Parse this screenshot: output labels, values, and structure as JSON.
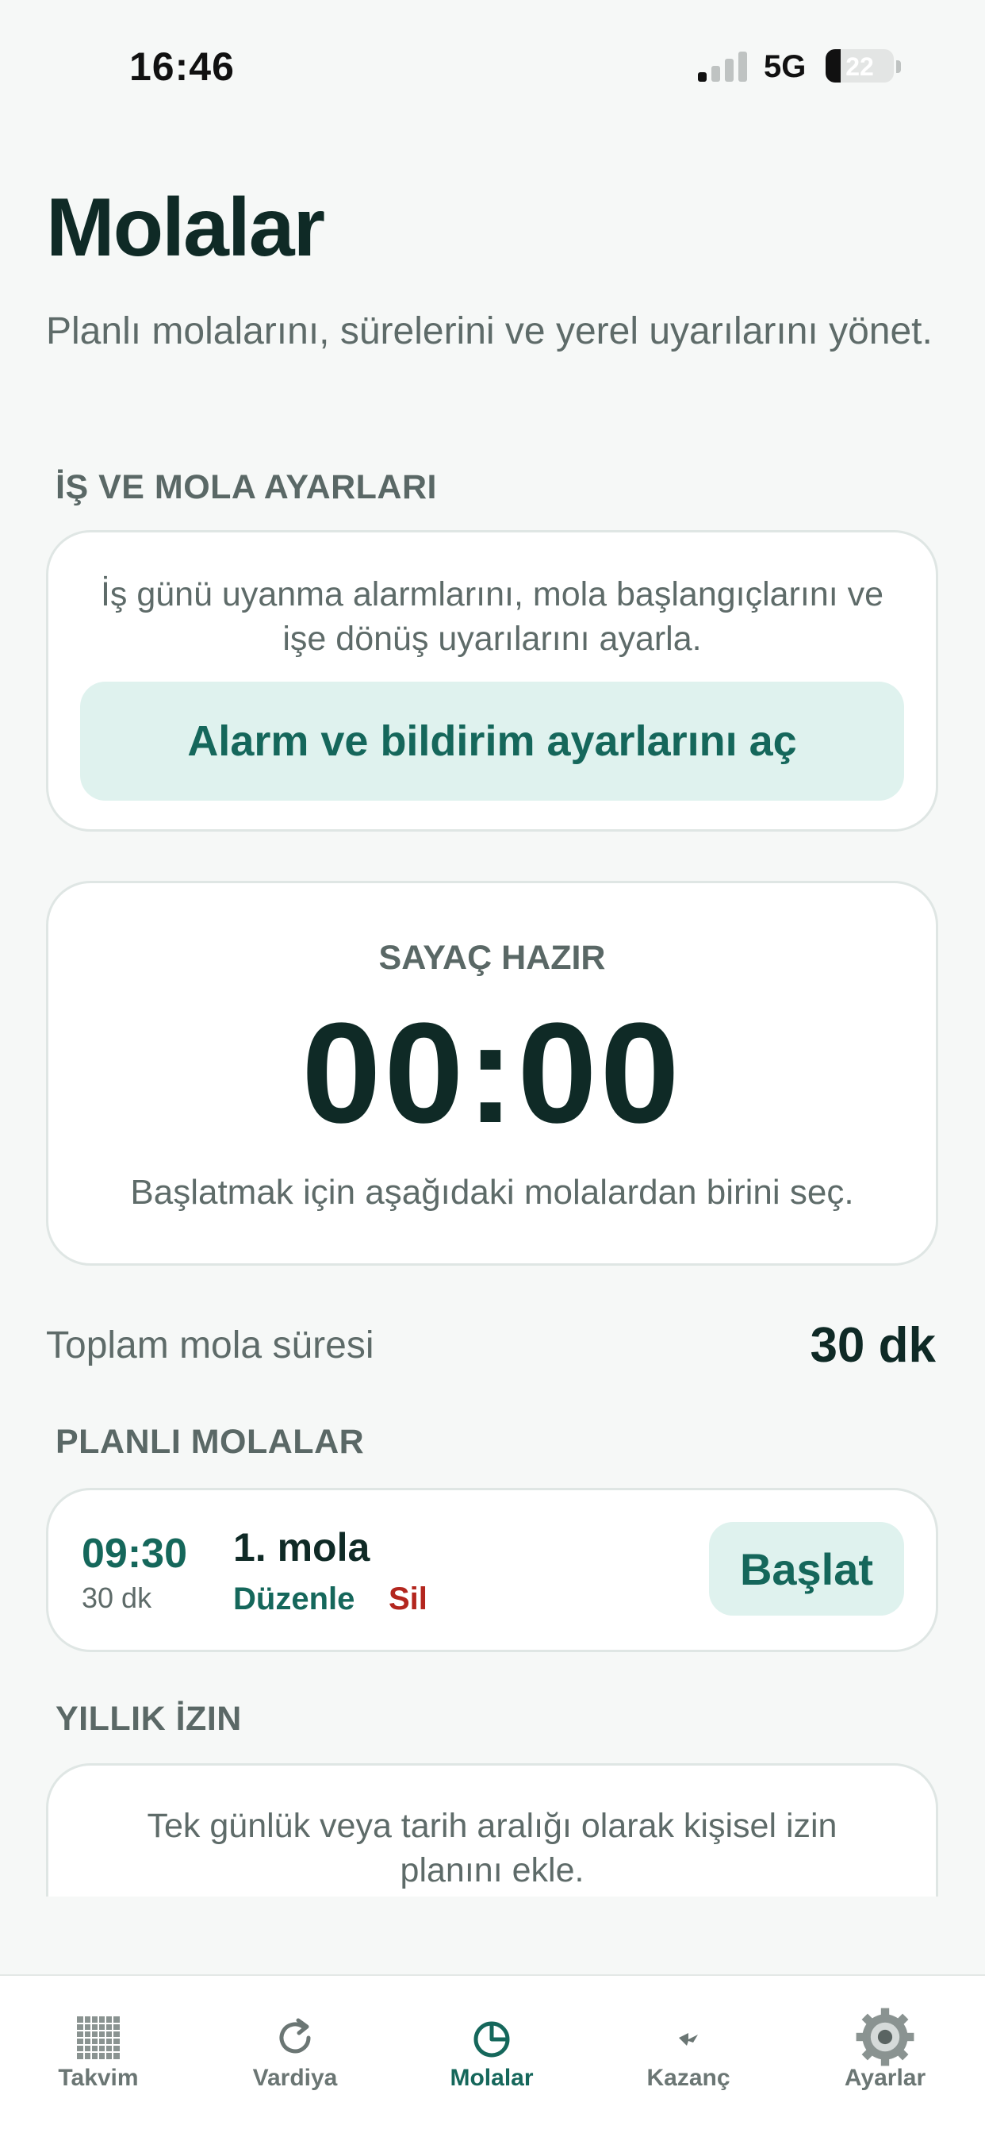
{
  "status_bar": {
    "time": "16:46",
    "network": "5G",
    "battery": "22",
    "battery_level_percent": 22
  },
  "header": {
    "title": "Molalar",
    "subtitle": "Planlı molalarını, sürelerini ve yerel uyarılarını yönet."
  },
  "settings_section": {
    "label": "İŞ VE MOLA AYARLARI",
    "description": "İş günü uyanma alarmlarını, mola başlangıçlarını ve işe dönüş uyarılarını ayarla.",
    "button_label": "Alarm ve bildirim ayarlarını aç"
  },
  "timer": {
    "status": "SAYAÇ HAZIR",
    "value": "00:00",
    "hint": "Başlatmak için aşağıdaki molalardan birini seç."
  },
  "total": {
    "label": "Toplam mola süresi",
    "value": "30 dk"
  },
  "planned_breaks": {
    "label": "PLANLI MOLALAR",
    "items": [
      {
        "time": "09:30",
        "duration": "30 dk",
        "name": "1. mola",
        "edit_label": "Düzenle",
        "delete_label": "Sil",
        "start_label": "Başlat"
      }
    ]
  },
  "annual_leave": {
    "label": "YILLIK İZIN",
    "description": "Tek günlük veya tarih aralığı olarak kişisel izin planını ekle."
  },
  "tab_bar": {
    "active": "Molalar",
    "tabs": [
      {
        "label": "Takvim",
        "icon": "calendar-grid-icon"
      },
      {
        "label": "Vardiya",
        "icon": "refresh-icon"
      },
      {
        "label": "Molalar",
        "icon": "clock-icon"
      },
      {
        "label": "Kazanç",
        "icon": "lightning-icon"
      },
      {
        "label": "Ayarlar",
        "icon": "gear-icon"
      }
    ]
  },
  "colors": {
    "accent": "#15675b",
    "accent_bg": "#dff2ee",
    "danger": "#b3261e",
    "background": "#f6f8f7",
    "text_primary": "#0f2a26",
    "text_secondary": "#5e6b69"
  }
}
